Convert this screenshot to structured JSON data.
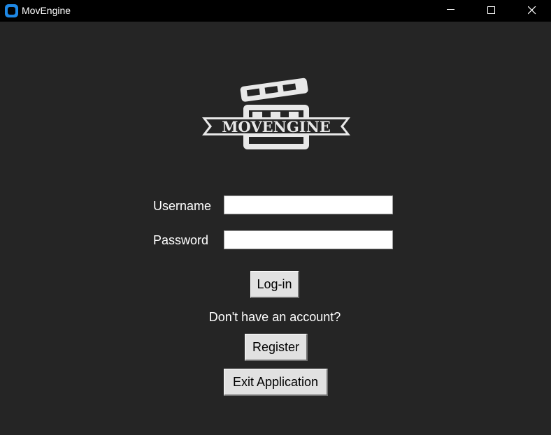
{
  "window": {
    "title": "MovEngine",
    "controls": {
      "minimize_icon": "minimize-icon",
      "maximize_icon": "maximize-icon",
      "close_icon": "close-icon"
    }
  },
  "logo": {
    "text": "MOVENGINE",
    "icon": "clapperboard-icon"
  },
  "form": {
    "username_label": "Username",
    "username_value": "",
    "password_label": "Password",
    "password_value": ""
  },
  "buttons": {
    "login_label": "Log-in",
    "register_label": "Register",
    "exit_label": "Exit Application"
  },
  "prompt": {
    "no_account_text": "Don't have an account?"
  },
  "colors": {
    "background": "#252525",
    "titlebar": "#000000",
    "text": "#ffffff",
    "button_face": "#e1e1e1",
    "app_icon": "#1e88e5"
  }
}
